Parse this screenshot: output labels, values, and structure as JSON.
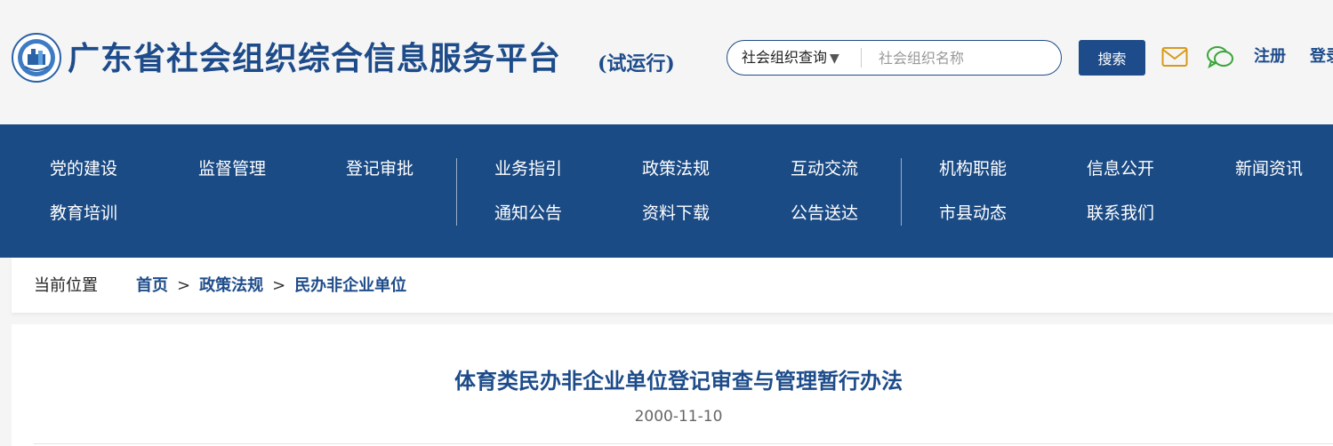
{
  "header": {
    "site_title": "广东省社会组织综合信息服务平台",
    "site_subtitle": "(试运行)",
    "colors": {
      "brand": "#1e4c8a",
      "nav_bg": "#1b4b85",
      "mail_icon": "#d79a1a",
      "chat_icon": "#3aa53a"
    },
    "search": {
      "type_label": "社会组织查询",
      "placeholder": "社会组织名称",
      "value": "",
      "button_label": "搜索"
    },
    "icons": [
      "mail-icon",
      "chat-icon"
    ],
    "register_label": "注册",
    "login_label": "登录"
  },
  "nav": {
    "items": [
      "党的建设",
      "监督管理",
      "登记审批",
      "业务指引",
      "政策法规",
      "互动交流",
      "机构职能",
      "信息公开",
      "新闻资讯",
      "教育培训",
      "通知公告",
      "资料下载",
      "公告送达",
      "市县动态",
      "联系我们"
    ]
  },
  "breadcrumb": {
    "label": "当前位置",
    "trail": [
      "首页",
      "政策法规",
      "民办非企业单位"
    ],
    "separator": ">"
  },
  "article": {
    "title": "体育类民办非企业单位登记审查与管理暂行办法",
    "date": "2000-11-10"
  }
}
